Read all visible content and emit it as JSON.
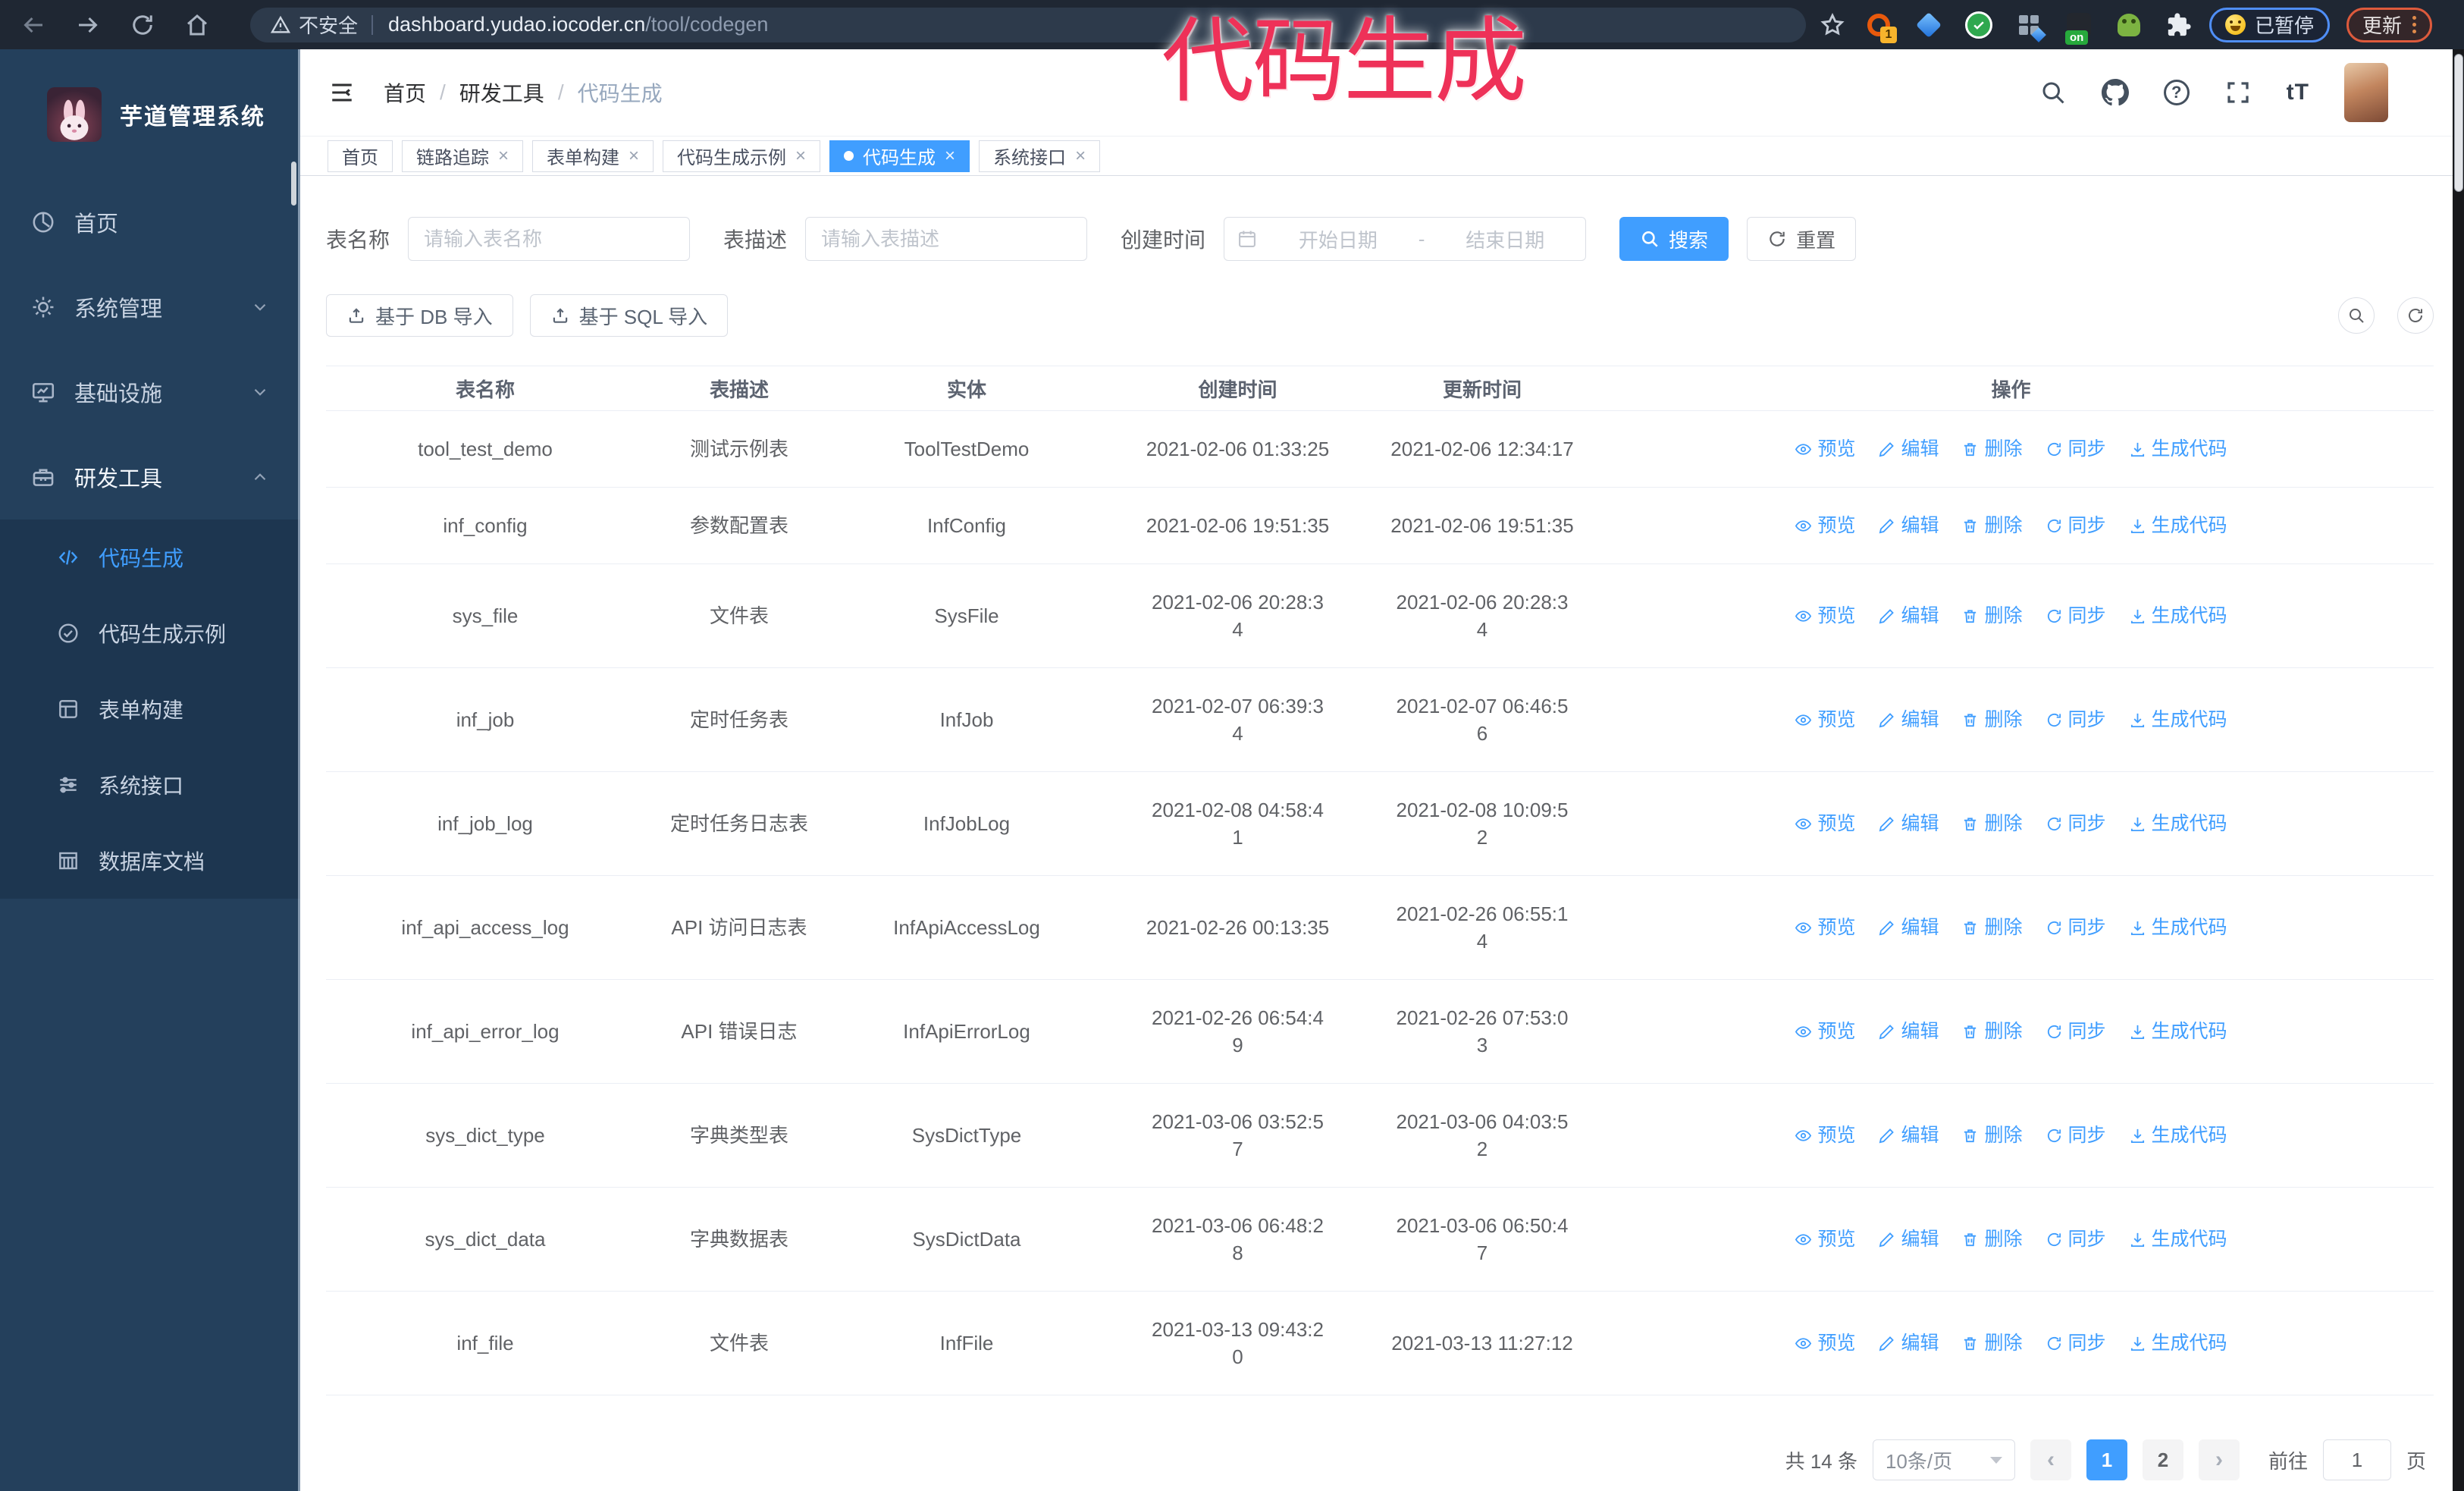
{
  "browser": {
    "security_label": "不安全",
    "url_host": "dashboard.yudao.iocoder.cn",
    "url_path": "/tool/codegen",
    "extension_badge": "1",
    "extension_on_badge": "on",
    "paused_badge": "已暂停",
    "update_button": "更新"
  },
  "annotation": {
    "text": "代码生成"
  },
  "sidebar": {
    "app_title": "芋道管理系统",
    "menu": [
      {
        "label": "首页",
        "icon": "dashboard-icon"
      },
      {
        "label": "系统管理",
        "icon": "gear-icon"
      },
      {
        "label": "基础设施",
        "icon": "monitor-icon"
      },
      {
        "label": "研发工具",
        "icon": "toolbox-icon"
      }
    ],
    "submenu": [
      {
        "label": "代码生成",
        "icon": "code-icon"
      },
      {
        "label": "代码生成示例",
        "icon": "circle-check-icon"
      },
      {
        "label": "表单构建",
        "icon": "form-icon"
      },
      {
        "label": "系统接口",
        "icon": "sliders-icon"
      },
      {
        "label": "数据库文档",
        "icon": "database-doc-icon"
      }
    ]
  },
  "header": {
    "breadcrumb": [
      "首页",
      "研发工具",
      "代码生成"
    ]
  },
  "tabs": [
    {
      "label": "首页"
    },
    {
      "label": "链路追踪"
    },
    {
      "label": "表单构建"
    },
    {
      "label": "代码生成示例"
    },
    {
      "label": "代码生成"
    },
    {
      "label": "系统接口"
    }
  ],
  "filters": {
    "table_name_label": "表名称",
    "table_name_placeholder": "请输入表名称",
    "table_desc_label": "表描述",
    "table_desc_placeholder": "请输入表描述",
    "create_time_label": "创建时间",
    "date_start_placeholder": "开始日期",
    "date_separator": "-",
    "date_end_placeholder": "结束日期",
    "search_button": "搜索",
    "reset_button": "重置"
  },
  "toolbar": {
    "import_db_button": "基于 DB 导入",
    "import_sql_button": "基于 SQL 导入"
  },
  "table": {
    "columns": [
      "表名称",
      "表描述",
      "实体",
      "创建时间",
      "更新时间",
      "操作"
    ],
    "actions": [
      "预览",
      "编辑",
      "删除",
      "同步",
      "生成代码"
    ],
    "action_icons": [
      "eye-icon",
      "edit-icon",
      "trash-icon",
      "sync-icon",
      "download-icon"
    ],
    "rows": [
      {
        "name": "tool_test_demo",
        "desc": "测试示例表",
        "entity": "ToolTestDemo",
        "create_time": "2021-02-06 01:33:25",
        "update_time": "2021-02-06 12:34:17"
      },
      {
        "name": "inf_config",
        "desc": "参数配置表",
        "entity": "InfConfig",
        "create_time": "2021-02-06 19:51:35",
        "update_time": "2021-02-06 19:51:35"
      },
      {
        "name": "sys_file",
        "desc": "文件表",
        "entity": "SysFile",
        "create_time": "2021-02-06 20:28:3\n4",
        "update_time": "2021-02-06 20:28:3\n4"
      },
      {
        "name": "inf_job",
        "desc": "定时任务表",
        "entity": "InfJob",
        "create_time": "2021-02-07 06:39:3\n4",
        "update_time": "2021-02-07 06:46:5\n6"
      },
      {
        "name": "inf_job_log",
        "desc": "定时任务日志表",
        "entity": "InfJobLog",
        "create_time": "2021-02-08 04:58:4\n1",
        "update_time": "2021-02-08 10:09:5\n2"
      },
      {
        "name": "inf_api_access_log",
        "desc": "API 访问日志表",
        "entity": "InfApiAccessLog",
        "create_time": "2021-02-26 00:13:35",
        "update_time": "2021-02-26 06:55:1\n4"
      },
      {
        "name": "inf_api_error_log",
        "desc": "API 错误日志",
        "entity": "InfApiErrorLog",
        "create_time": "2021-02-26 06:54:4\n9",
        "update_time": "2021-02-26 07:53:0\n3"
      },
      {
        "name": "sys_dict_type",
        "desc": "字典类型表",
        "entity": "SysDictType",
        "create_time": "2021-03-06 03:52:5\n7",
        "update_time": "2021-03-06 04:03:5\n2"
      },
      {
        "name": "sys_dict_data",
        "desc": "字典数据表",
        "entity": "SysDictData",
        "create_time": "2021-03-06 06:48:2\n8",
        "update_time": "2021-03-06 06:50:4\n7"
      },
      {
        "name": "inf_file",
        "desc": "文件表",
        "entity": "InfFile",
        "create_time": "2021-03-13 09:43:2\n0",
        "update_time": "2021-03-13 11:27:12"
      }
    ]
  },
  "pagination": {
    "total_label": "共 14 条",
    "page_size": "10条/页",
    "pages": [
      "1",
      "2"
    ],
    "active_page": "1",
    "goto_label": "前往",
    "goto_value": "1",
    "goto_suffix": "页"
  },
  "colors": {
    "accent": "#409eff",
    "annotation": "#ee3158",
    "sidebar_bg": "#24405c",
    "submenu_bg": "#1d3650"
  }
}
